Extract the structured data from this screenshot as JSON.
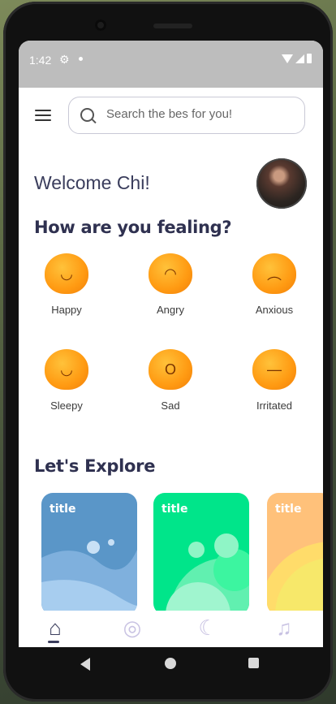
{
  "status": {
    "time": "1:42"
  },
  "search": {
    "placeholder": "Search the bes for you!"
  },
  "greeting": "Welcome Chi!",
  "mood_heading": "How are you fealing?",
  "moods": [
    {
      "label": "Happy",
      "icon": "happy-emoji"
    },
    {
      "label": "Angry",
      "icon": "angry-emoji"
    },
    {
      "label": "Anxious",
      "icon": "anxious-emoji"
    },
    {
      "label": "Sleepy",
      "icon": "sleepy-emoji"
    },
    {
      "label": "Sad",
      "icon": "sad-emoji"
    },
    {
      "label": "Irritated",
      "icon": "irritated-emoji"
    }
  ],
  "explore_heading": "Let's Explore",
  "cards": [
    {
      "title": "title",
      "color": "#5a96c8"
    },
    {
      "title": "title",
      "color": "#00e58a"
    },
    {
      "title": "title",
      "color": "#ffc17a"
    }
  ],
  "nav": [
    {
      "icon": "home-icon"
    },
    {
      "icon": "disc-music-icon"
    },
    {
      "icon": "moon-icon"
    },
    {
      "icon": "music-note-icon"
    }
  ]
}
